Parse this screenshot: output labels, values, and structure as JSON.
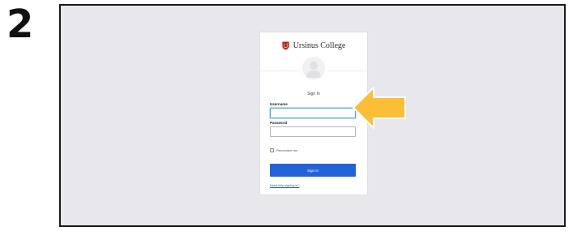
{
  "step": {
    "number": "2"
  },
  "login": {
    "brand_name": "Ursinus College",
    "title": "Sign In",
    "username_label": "Username",
    "username_value": "",
    "password_label": "Password",
    "password_value": "",
    "remember_label": "Remember me",
    "remember_checked": false,
    "submit_label": "Sign In",
    "help_link": "Need help signing in?"
  },
  "icons": {
    "brand_logo": "shield-icon",
    "user_avatar": "user-avatar-icon",
    "callout": "arrow-left-icon"
  },
  "colors": {
    "brand_red": "#b51f24",
    "primary_blue": "#2362d9",
    "focus_blue": "#58a7d9",
    "callout_yellow": "#fbbf37",
    "frame_background": "#e8e7ec"
  }
}
